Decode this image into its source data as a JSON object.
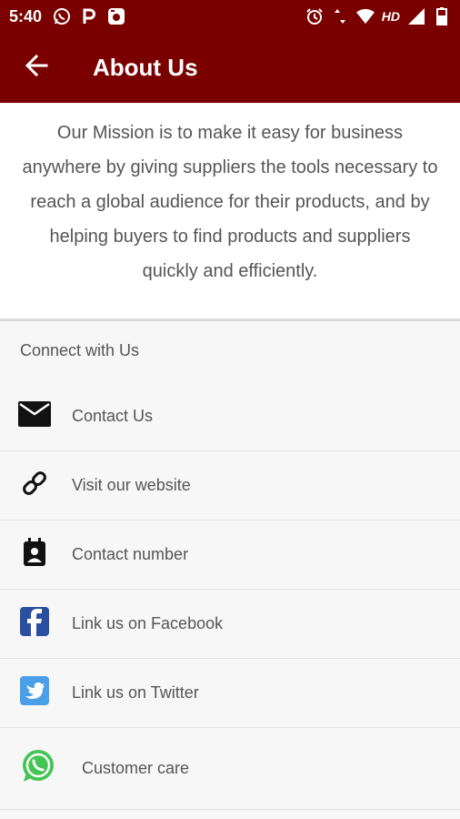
{
  "status_bar": {
    "time": "5:40",
    "network_label": "HD",
    "left_icons": [
      "whatsapp-icon",
      "p-icon",
      "camera-app-icon"
    ],
    "right_icons": [
      "alarm-icon",
      "data-arrows-icon",
      "wifi-icon",
      "signal-icon",
      "battery-icon"
    ]
  },
  "app_bar": {
    "title": "About Us",
    "back_icon": "arrow-back-icon",
    "color": "#7a0000"
  },
  "mission": {
    "text": "Our Mission is to make it easy for business anywhere by giving suppliers the tools necessary to reach a global audience for their products, and by helping buyers to find products and suppliers quickly and efficiently."
  },
  "connect": {
    "header": "Connect with Us",
    "items": [
      {
        "label": "Contact Us",
        "icon": "mail-icon"
      },
      {
        "label": "Visit our website",
        "icon": "link-icon"
      },
      {
        "label": "Contact number",
        "icon": "contact-card-icon"
      },
      {
        "label": "Link us on Facebook",
        "icon": "facebook-icon",
        "color": "#3b5998"
      },
      {
        "label": "Link us on Twitter",
        "icon": "twitter-icon",
        "color": "#4a9fe8"
      },
      {
        "label": "Customer care",
        "icon": "whatsapp-icon",
        "color": "#43c553"
      }
    ]
  }
}
